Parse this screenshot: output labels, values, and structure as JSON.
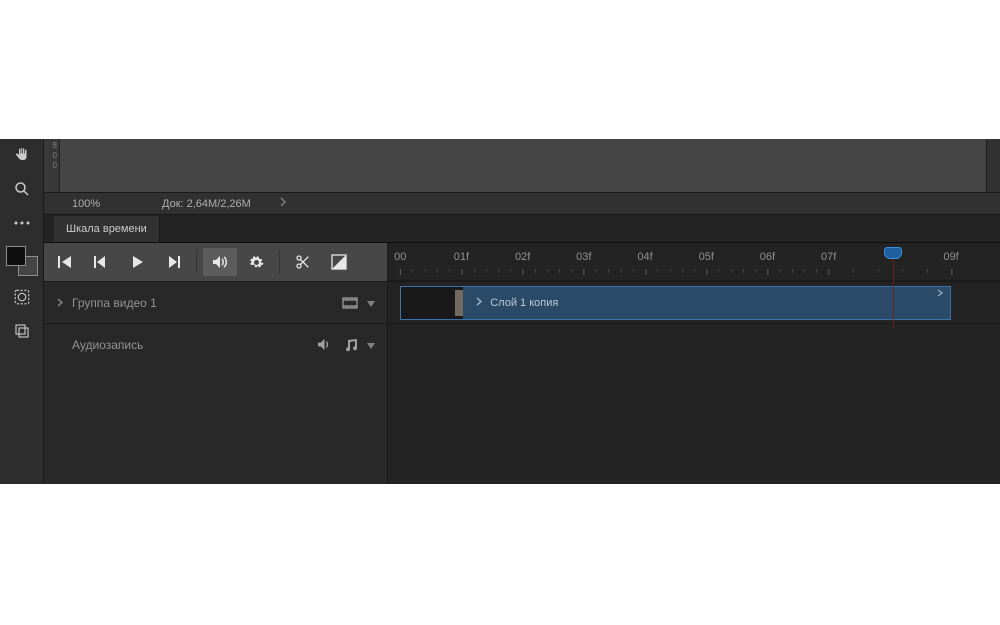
{
  "toolstrip": {
    "icons": [
      "hand-icon",
      "zoom-icon",
      "more-icon",
      "swatches",
      "mask-icon",
      "artboard-icon"
    ]
  },
  "doc_ruler": {
    "labels": [
      "8",
      "0",
      "0"
    ]
  },
  "status": {
    "zoom": "100%",
    "doc": "Док: 2,64M/2,26M"
  },
  "panel": {
    "tab": "Шкала времени"
  },
  "transport": {
    "buttons": [
      "first-frame",
      "prev-frame",
      "play",
      "next-frame",
      "audio",
      "settings",
      "split",
      "transition"
    ],
    "audio_active": true
  },
  "layers": {
    "group": {
      "name": "Группа видео 1"
    },
    "audio": {
      "name": "Аудиозапись"
    }
  },
  "ruler": {
    "labels": [
      "00",
      "01f",
      "02f",
      "03f",
      "04f",
      "05f",
      "06f",
      "07f",
      "09f"
    ],
    "positions_pct": [
      2,
      12,
      22,
      32,
      42,
      52,
      62,
      72,
      92
    ],
    "playhead_pct": 82.5,
    "clip": {
      "label": "Слой 1 копия",
      "left_pct": 2,
      "right_pct": 92
    }
  },
  "colors": {
    "clip_bg": "#1d3f5f",
    "clip_border": "#2d6aa8",
    "playhead": "#1f5f9f"
  }
}
